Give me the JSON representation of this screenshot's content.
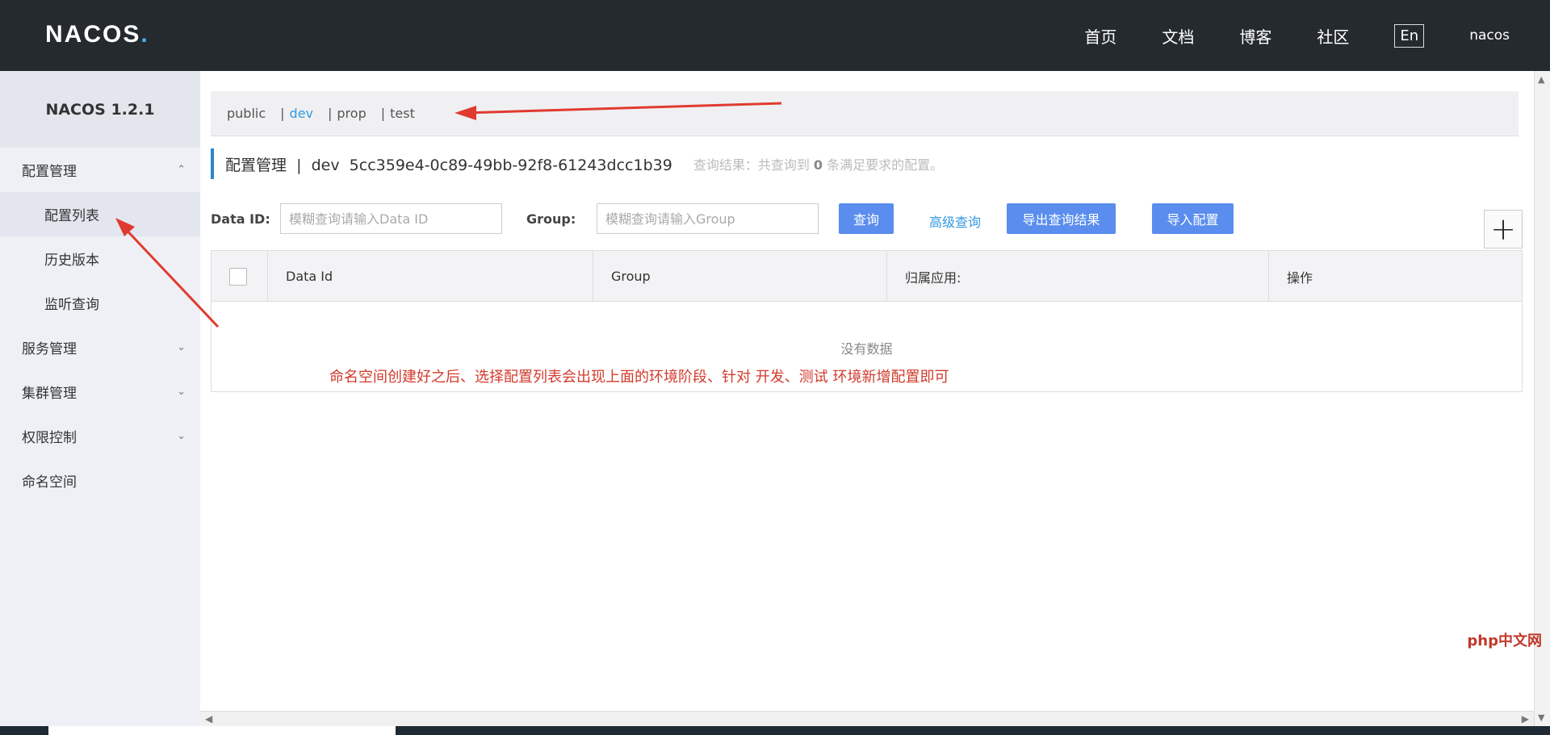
{
  "header": {
    "logo_text": "NACOS",
    "nav": [
      "首页",
      "文档",
      "博客",
      "社区"
    ],
    "lang_button": "En",
    "user": "nacos"
  },
  "sidebar": {
    "version": "NACOS 1.2.1",
    "groups": [
      {
        "label": "配置管理",
        "expanded": true,
        "items": [
          "配置列表",
          "历史版本",
          "监听查询"
        ]
      },
      {
        "label": "服务管理",
        "expanded": false
      },
      {
        "label": "集群管理",
        "expanded": false
      },
      {
        "label": "权限控制",
        "expanded": false
      },
      {
        "label": "命名空间"
      }
    ],
    "active_item": "配置列表"
  },
  "namespaces": {
    "items": [
      "public",
      "dev",
      "prop",
      "test"
    ],
    "active": "dev"
  },
  "page": {
    "title": "配置管理",
    "namespace_name": "dev",
    "namespace_id": "5cc359e4-0c89-49bb-92f8-61243dcc1b39",
    "summary_prefix": "查询结果：共查询到",
    "summary_count": "0",
    "summary_suffix": "条满足要求的配置。"
  },
  "search": {
    "data_id_label": "Data ID:",
    "data_id_placeholder": "模糊查询请输入Data ID",
    "group_label": "Group:",
    "group_placeholder": "模糊查询请输入Group",
    "query_button": "查询",
    "advanced_link": "高级查询",
    "export_button": "导出查询结果",
    "import_button": "导入配置",
    "add_button": "+"
  },
  "table": {
    "columns": [
      "Data Id",
      "Group",
      "归属应用:",
      "操作"
    ],
    "empty_text": "没有数据"
  },
  "annotation": "命名空间创建好之后、选择配置列表会出现上面的环境阶段、针对 开发、测试 环境新增配置即可",
  "watermark": "php中文网",
  "colors": {
    "header_bg": "#252a2f",
    "accent": "#5a8dee",
    "link": "#3499e0",
    "annotation": "#d23a2c"
  }
}
